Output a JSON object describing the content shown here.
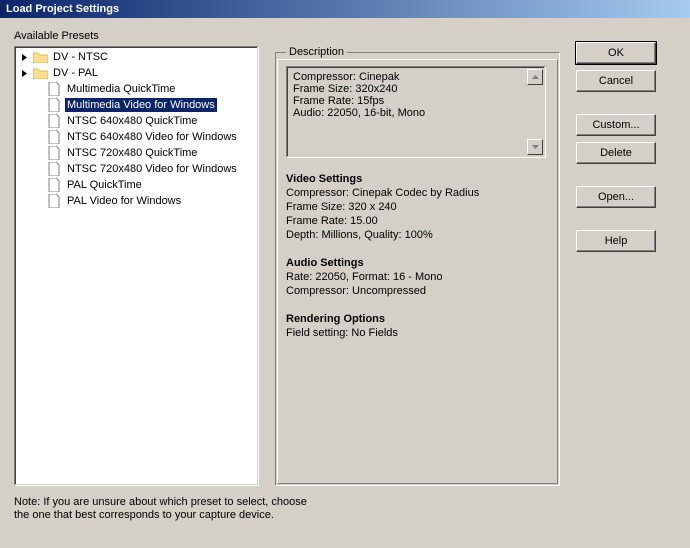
{
  "window": {
    "title": "Load Project Settings"
  },
  "labels": {
    "available": "Available Presets",
    "description_legend": "Description",
    "note_line1": "Note: If you are unsure about which preset to select, choose",
    "note_line2": "the one that best corresponds to your capture device."
  },
  "tree": {
    "items": [
      {
        "type": "folder",
        "label": "DV - NTSC",
        "expandable": true
      },
      {
        "type": "folder",
        "label": "DV - PAL",
        "expandable": true
      },
      {
        "type": "file",
        "label": "Multimedia QuickTime"
      },
      {
        "type": "file",
        "label": "Multimedia Video for Windows",
        "selected": true
      },
      {
        "type": "file",
        "label": "NTSC 640x480 QuickTime"
      },
      {
        "type": "file",
        "label": "NTSC 640x480 Video for Windows"
      },
      {
        "type": "file",
        "label": "NTSC 720x480 QuickTime"
      },
      {
        "type": "file",
        "label": "NTSC 720x480 Video for Windows"
      },
      {
        "type": "file",
        "label": "PAL QuickTime"
      },
      {
        "type": "file",
        "label": "PAL Video for Windows"
      }
    ]
  },
  "summary": {
    "line1": "Compressor: Cinepak",
    "line2": "Frame Size: 320x240",
    "line3": "Frame Rate: 15fps",
    "line4": "Audio: 22050, 16-bit, Mono"
  },
  "details": {
    "video_heading": "Video Settings",
    "video_l1": "Compressor: Cinepak Codec by Radius",
    "video_l2": "Frame Size: 320 x 240",
    "video_l3": "Frame Rate: 15.00",
    "video_l4": "Depth: Millions, Quality: 100%",
    "audio_heading": "Audio Settings",
    "audio_l1": "Rate: 22050, Format: 16 - Mono",
    "audio_l2": "Compressor: Uncompressed",
    "render_heading": "Rendering Options",
    "render_l1": "Field setting: No Fields"
  },
  "buttons": {
    "ok": "OK",
    "cancel": "Cancel",
    "custom": "Custom...",
    "delete": "Delete",
    "open": "Open...",
    "help": "Help"
  }
}
